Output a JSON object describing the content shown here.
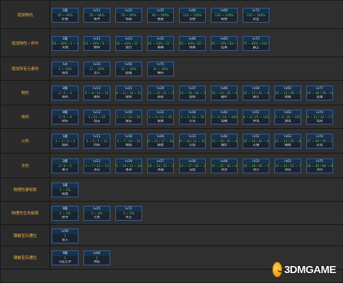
{
  "rows": [
    {
      "label": "增加物抗",
      "cells": [
        {
          "tag": "1级",
          "range": "20 ~ 46%",
          "name": "护盾"
        },
        {
          "tag": "lv11",
          "range": "50 ~ 68%",
          "name": "铁甲"
        },
        {
          "tag": "lv23",
          "range": "70 ~ 90%",
          "name": "龟盾"
        },
        {
          "tag": "lv35",
          "range": "90 ~ 109%",
          "name": "重盾"
        },
        {
          "tag": "lv46",
          "range": "110 ~ 129%",
          "name": "坚壁"
        },
        {
          "tag": "lv60",
          "range": "130 ~ 149%",
          "name": "铁壁"
        },
        {
          "tag": "lv73",
          "range": "150 ~ 169%",
          "name": "堡垒"
        }
      ]
    },
    {
      "label": "增加物伤 / 命中",
      "cells": [
        {
          "tag": "1级",
          "range": "20 ~ 44% / 1 ~ 6",
          "name": "尖锐"
        },
        {
          "tag": "lv11",
          "range": "25 ~ 34% / 9 ~ 30",
          "name": "致命"
        },
        {
          "tag": "lv23",
          "range": "35 ~ 44% / 31 ~ 50",
          "name": "强力"
        },
        {
          "tag": "lv35",
          "range": "45 ~ 54% / 51 ~ 64",
          "name": "暴躁"
        },
        {
          "tag": "lv46",
          "range": "55 ~ 64% / 65 ~ 82",
          "name": "残暴"
        },
        {
          "tag": "lv60",
          "range": "65 ~ 74% / 83 ~ 100",
          "name": "狂暴"
        },
        {
          "tag": "lv73",
          "range": "75 ~ 80% / 100 ~ 120",
          "name": "霸王"
        }
      ]
    },
    {
      "label": "增加所有元素伤",
      "cells": [
        {
          "tag": "lv4",
          "range": "5 ~ 10%",
          "name": "强化"
        },
        {
          "tag": "lv33",
          "range": "11 ~ 20%",
          "name": "注入"
        },
        {
          "tag": "lv50",
          "range": "21 ~ 30%",
          "name": "超强"
        },
        {
          "tag": "lv75",
          "range": "31 ~ 40%",
          "name": "横扫"
        }
      ]
    },
    {
      "label": "物伤",
      "cells": [
        {
          "tag": "2级",
          "range": "2 / 4 ~ 3",
          "name": "锋利"
        },
        {
          "tag": "lv13",
          "range": "6 ~ 8 / 12 ~ 14",
          "name": "锋利"
        },
        {
          "tag": "lv21",
          "range": "9 ~ 12 / 18 ~ 21",
          "name": "锐利"
        },
        {
          "tag": "lv29",
          "range": "11 ~ 15 / 21 ~ 27",
          "name": "邪恶"
        },
        {
          "tag": "lv37",
          "range": "14 ~ 18 / 28 ~ 33",
          "name": "凶残"
        },
        {
          "tag": "lv46",
          "range": "18 ~ 24 / 36 ~ 42",
          "name": "破坏"
        },
        {
          "tag": "lv54",
          "range": "20 ~ 27 / 41 ~ 48",
          "name": "毁灭"
        },
        {
          "tag": "lv65",
          "range": "24 ~ 33 / 49 ~ 57",
          "name": "残暴"
        },
        {
          "tag": "lv77",
          "range": "29 ~ 38 / 58 ~ 68",
          "name": "恶毒"
        }
      ]
    },
    {
      "label": "电伤",
      "cells": [
        {
          "tag": "9级",
          "range": "1 / 6 ~ 9",
          "name": "刺伤"
        },
        {
          "tag": "lv13",
          "range": "1 / 23 ~ 25",
          "name": "电击"
        },
        {
          "tag": "lv19",
          "range": "1 ~ 2 / 10 ~ 53",
          "name": "雷击"
        },
        {
          "tag": "lv31",
          "range": "2 ~ 4 / 11 ~ 65",
          "name": "雷霆"
        },
        {
          "tag": "lv34",
          "range": "2 ~ 5 / 18 ~ 79",
          "name": "火花"
        },
        {
          "tag": "lv42",
          "range": "3 ~ 6 / 20 ~ 100",
          "name": "电磁"
        },
        {
          "tag": "lv51",
          "range": "4 ~ 8 / 25 ~ 121",
          "name": "导电"
        },
        {
          "tag": "lv63",
          "range": "5 ~ 9 / 30 ~ 151",
          "name": "放电"
        },
        {
          "tag": "lv74",
          "range": "6 ~ 11 / 33 ~ 178",
          "name": "电光"
        }
      ]
    },
    {
      "label": "火伤",
      "cells": [
        {
          "tag": "1级",
          "range": "1 ~ 2 / 3 ~ 4",
          "name": "加热"
        },
        {
          "tag": "lv11",
          "range": "3 ~ 5 / 7 ~ 11",
          "name": "灼热"
        },
        {
          "tag": "lv18",
          "range": "4 ~ 7 / 10 ~ 15",
          "name": "燃烧"
        },
        {
          "tag": "lv26",
          "range": "6 ~ 11 / 17 ~ 26",
          "name": "熔岩"
        },
        {
          "tag": "lv33",
          "range": "9 ~ 14 / 21 ~ 35",
          "name": "火焰"
        },
        {
          "tag": "lv42",
          "range": "13 ~ 19 / 30 ~ 45",
          "name": "爆炸"
        },
        {
          "tag": "lv51",
          "range": "16 ~ 25 / 42 ~ 60",
          "name": "灾难"
        },
        {
          "tag": "lv63",
          "range": "21 ~ 33 / 55 ~ 80",
          "name": "爆燃"
        },
        {
          "tag": "lv74",
          "range": "27 ~ 40 / 70 ~ 102",
          "name": "火化"
        }
      ]
    },
    {
      "label": "冰伤",
      "cells": [
        {
          "tag": "2级",
          "range": "2 / 4 ~ 5",
          "name": "寒冷"
        },
        {
          "tag": "lv12",
          "range": "3 ~ 7 / 10 ~ 13",
          "name": "冰冻"
        },
        {
          "tag": "lv19",
          "range": "5 ~ 10 / 13 ~ 20",
          "name": "寒冰"
        },
        {
          "tag": "lv27",
          "range": "10 ~ 14 / 25 ~ 31",
          "name": "冰霜"
        },
        {
          "tag": "lv34",
          "range": "12 ~ 17 / 30 ~ 36",
          "name": "冻结"
        },
        {
          "tag": "lv44",
          "range": "15 ~ 22 / 36 ~ 45",
          "name": "冰封"
        },
        {
          "tag": "lv53",
          "range": "19 ~ 28 / 46 ~ 58",
          "name": "冰川"
        },
        {
          "tag": "lv63",
          "range": "23 ~ 34 / 55 ~ 71",
          "name": "冰风"
        },
        {
          "tag": "lv75",
          "range": "28 ~ 40 / 68 ~ 83",
          "name": "冰河"
        }
      ]
    },
    {
      "label": "物理伤害吸取",
      "cells": [
        {
          "tag": "1级",
          "range": "1 ~ 2%",
          "name": "吸血"
        }
      ]
    },
    {
      "label": "物理伤生命偷取",
      "cells": [
        {
          "tag": "9级",
          "range": "1 ~ 2%",
          "name": "掠夺"
        },
        {
          "tag": "lv25",
          "range": "3 ~ 4%",
          "name": "七星"
        },
        {
          "tag": "lv72",
          "range": "3 ~ 4%",
          "name": "帝王"
        }
      ]
    },
    {
      "label": "镶嵌宝石槽位",
      "cells": [
        {
          "tag": "lv50",
          "range": "1",
          "name": "嵌入"
        }
      ]
    },
    {
      "label": "镶嵌宝石槽位",
      "cells": [
        {
          "tag": "9级",
          "range": "1",
          "name": "巧匠之手"
        },
        {
          "tag": "lv64",
          "range": "2",
          "name": "神匠"
        }
      ]
    }
  ],
  "watermark": {
    "text": "3DMGAME",
    "icon": "smiley-logo-icon"
  },
  "colors": {
    "label": "#f0b04a",
    "range": "#5ad35a",
    "tag_bg": "#16324f",
    "border": "#3b5f86"
  }
}
